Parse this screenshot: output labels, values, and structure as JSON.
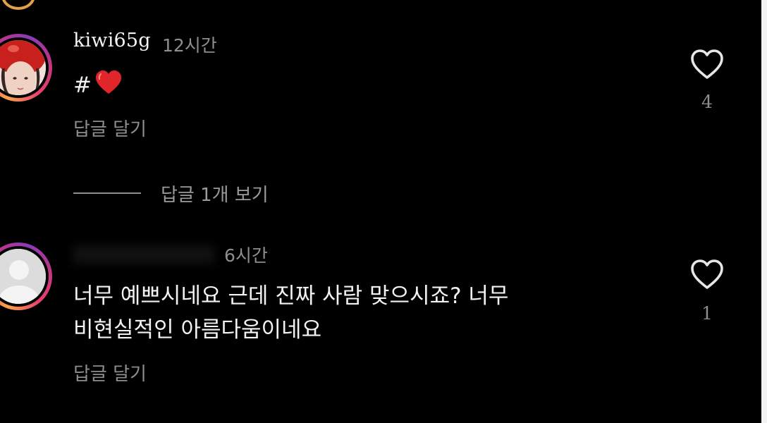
{
  "comments": [
    {
      "username": "kiwi65g",
      "time": "12시간",
      "text_prefix": "#",
      "text_icon": "red-heart-emoji",
      "reply_label": "답글 달기",
      "likes": "4",
      "view_replies_label": "답글 1개 보기"
    },
    {
      "username": "",
      "time": "6시간",
      "text_line1": "너무 예쁘시네요 근데 진짜 사람 맞으시죠? 너무",
      "text_line2": "비현실적인 아름다움이네요",
      "reply_label": "답글 달기",
      "likes": "1"
    }
  ],
  "colors": {
    "background": "#000000",
    "text_primary": "#f2f2f2",
    "text_secondary": "#8e8e8e",
    "heart": "#e0262b"
  },
  "icons": [
    "heart-outline-icon",
    "red-heart-emoji",
    "default-avatar-icon"
  ]
}
